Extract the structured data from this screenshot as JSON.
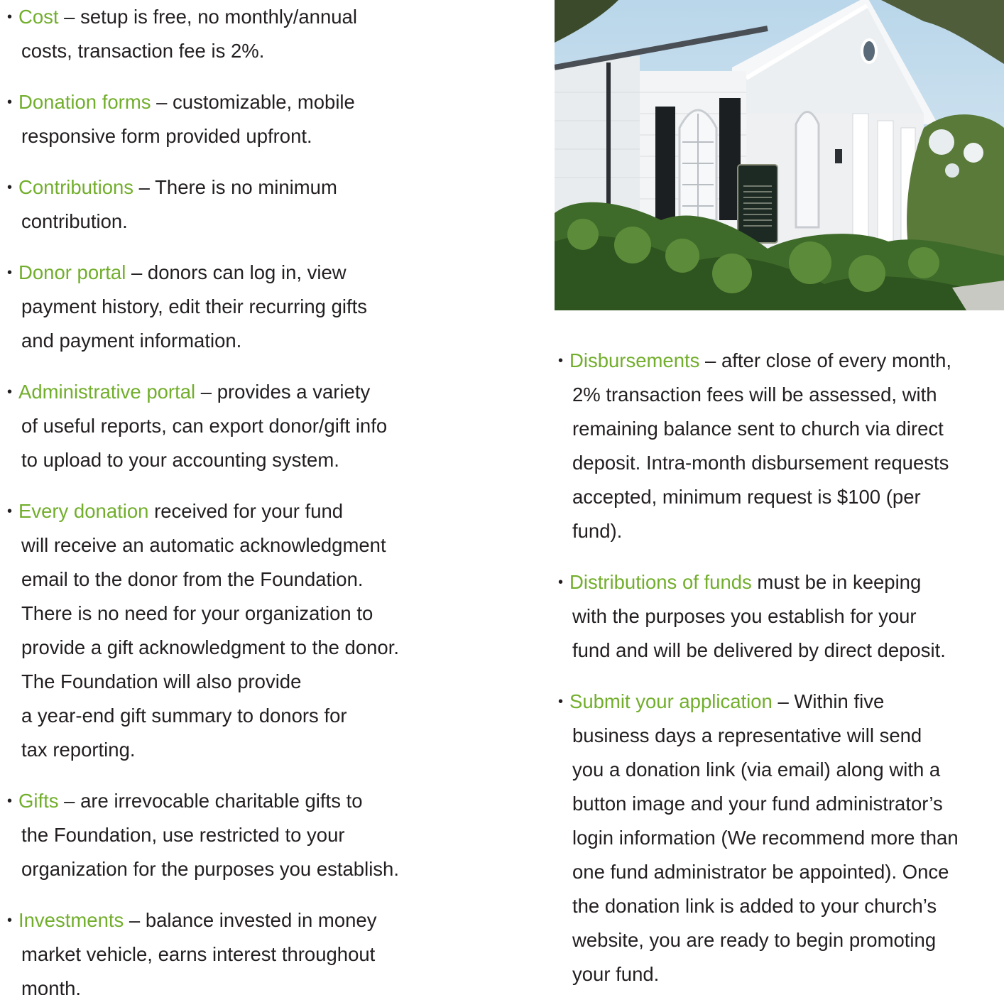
{
  "left_items": [
    {
      "head": "Cost",
      "lines": [
        " – setup is free, no monthly/annual",
        "costs, transaction fee is 2%."
      ]
    },
    {
      "head": "Donation forms",
      "lines": [
        " – customizable, mobile",
        "responsive form provided upfront."
      ]
    },
    {
      "head": "Contributions",
      "lines": [
        " – There is no minimum",
        "contribution."
      ]
    },
    {
      "head": "Donor portal",
      "lines": [
        " – donors can log in, view",
        "payment history, edit their recurring gifts",
        "and payment information."
      ]
    },
    {
      "head": "Administrative portal",
      "lines": [
        " – provides a variety",
        "of useful reports, can export donor/gift info",
        "to upload to your accounting system."
      ]
    },
    {
      "head": "Every donation",
      "lines": [
        " received for your fund",
        "will receive an automatic acknowledgment",
        "email to the donor from the Foundation.",
        "There is no need for your organization to",
        "provide a gift acknowledgment to the donor.",
        "The Foundation will also provide",
        "a year-end gift summary to donors for",
        "tax reporting."
      ]
    },
    {
      "head": "Gifts",
      "lines": [
        " – are irrevocable charitable gifts to",
        "the Foundation, use restricted to your",
        "organization for the purposes you establish."
      ]
    },
    {
      "head": "Investments",
      "lines": [
        " – balance invested in money",
        "market vehicle, earns interest throughout",
        "month."
      ]
    }
  ],
  "right_items": [
    {
      "head": "Disbursements",
      "lines": [
        " – after close of every month,",
        "2% transaction fees will be assessed, with",
        "remaining balance sent to church via direct",
        "deposit. Intra-month disbursement requests",
        "accepted, minimum request is $100 (per",
        "fund)."
      ]
    },
    {
      "head": "Distributions of funds",
      "lines": [
        " must be in keeping",
        "with the purposes you establish for your",
        "fund and will be delivered by direct deposit."
      ]
    },
    {
      "head": "Submit your application",
      "lines": [
        " – Within five",
        "business days a representative will send",
        "you a donation link (via email) along with a",
        "button image and your fund administrator’s",
        "login information (We recommend more than",
        "one fund administrator be appointed). Once",
        "the donation link is added to your church’s",
        "website, you are ready to begin promoting",
        "your fund."
      ]
    }
  ],
  "bullet_char": "•",
  "colors": {
    "highlight": "#72ae2c",
    "text": "#231f20"
  }
}
